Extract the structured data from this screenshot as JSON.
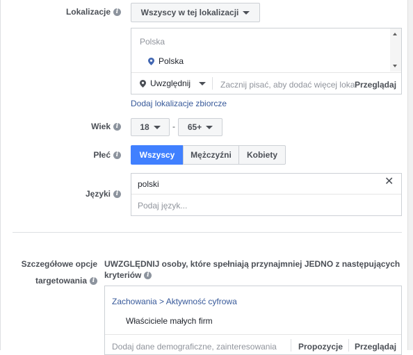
{
  "location": {
    "label": "Lokalizacje",
    "dropdown": "Wszyscy w tej lokalizacji",
    "group_header": "Polska",
    "selected_item": "Polska",
    "include_label": "Uwzględnij",
    "search_placeholder": "Zacznij pisać, aby dodać więcej lokalizacji",
    "browse": "Przeglądaj",
    "bulk_link": "Dodaj lokalizacje zbiorcze"
  },
  "age": {
    "label": "Wiek",
    "min": "18",
    "sep": "-",
    "max": "65+"
  },
  "gender": {
    "label": "Płeć",
    "options": [
      "Wszyscy",
      "Mężczyźni",
      "Kobiety"
    ],
    "selected": "Wszyscy"
  },
  "languages": {
    "label": "Języki",
    "selected": "polski",
    "placeholder": "Podaj język..."
  },
  "targeting": {
    "label_line1": "Szczegółowe opcje",
    "label_line2": "targetowania",
    "description_line1": "UWZGLĘDNIJ osoby, które spełniają przynajmniej JEDNO z następujących",
    "description_line2": "kryteriów",
    "breadcrumb": "Zachowania > Aktywność cyfrowa",
    "item": "Właściciele małych firm",
    "search_placeholder": "Dodaj dane demograficzne, zainteresowania",
    "suggestions": "Propozycje",
    "browse": "Przeglądaj"
  },
  "colors": {
    "accent": "#4080ff",
    "link": "#365899",
    "border": "#ccd0d5"
  }
}
